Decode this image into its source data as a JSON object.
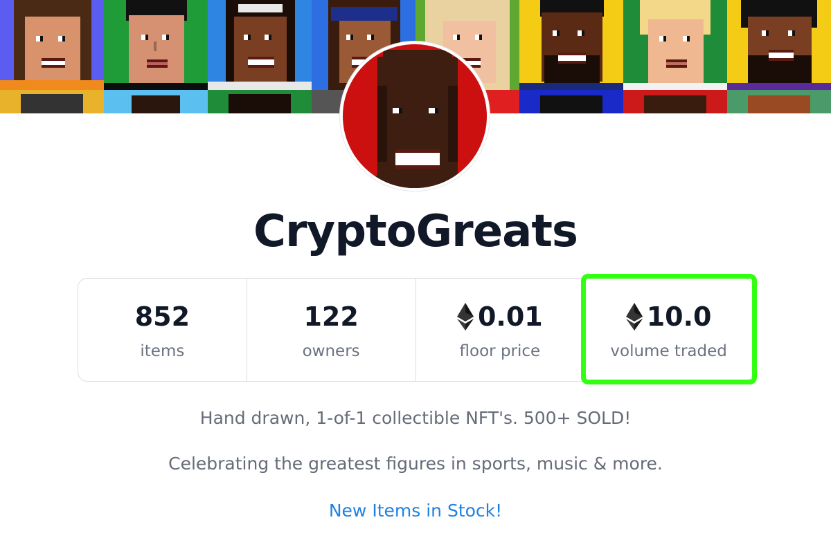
{
  "collection": {
    "name": "CryptoGreats"
  },
  "stats": [
    {
      "value": "852",
      "label": "items",
      "eth": false
    },
    {
      "value": "122",
      "label": "owners",
      "eth": false
    },
    {
      "value": "0.01",
      "label": "floor price",
      "eth": true
    },
    {
      "value": "10.0",
      "label": "volume traded",
      "eth": true
    }
  ],
  "description": {
    "line1": "Hand drawn, 1-of-1 collectible NFT's. 500+ SOLD!",
    "line2": "Celebrating the greatest figures in sports, music & more."
  },
  "link": {
    "label": "New Items in Stock!"
  },
  "colors": {
    "highlight": "#33ff12",
    "link": "#2181e2",
    "avatar_bg": "#cc1010"
  },
  "icons": {
    "currency": "ethereum-icon"
  }
}
